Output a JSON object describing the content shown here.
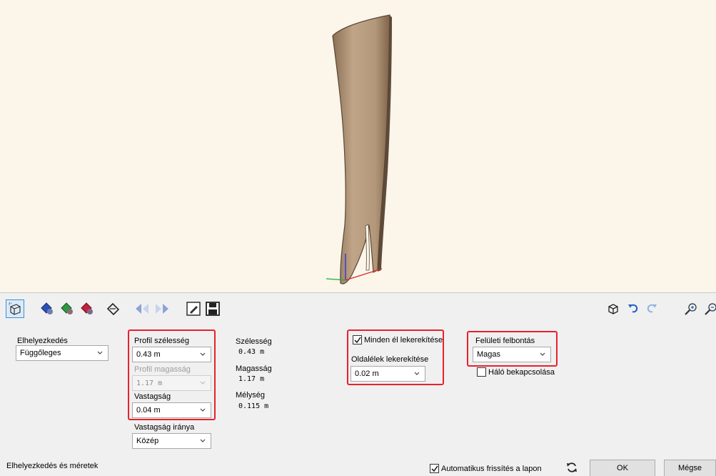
{
  "toolbar": {
    "icons": [
      "mesh-cube-icon",
      "paint-blue-icon",
      "paint-green-icon",
      "paint-red-icon",
      "paint-bucket-icon",
      "symmetry-left-icon",
      "symmetry-right-icon",
      "edit-pencil-icon",
      "save-icon",
      "view-cube-icon",
      "undo-icon",
      "redo-icon",
      "zoom-in-icon",
      "zoom-out-icon"
    ]
  },
  "placement": {
    "label": "Elhelyezkedés",
    "value": "Függőleges"
  },
  "profile": {
    "width_label": "Profil szélesség",
    "width_value": "0.43 m",
    "height_label": "Profil magasság",
    "height_value": "1.17 m",
    "thickness_label": "Vastagság",
    "thickness_value": "0.04 m",
    "thickness_dir_label": "Vastagság iránya",
    "thickness_dir_value": "Közép"
  },
  "dimensions": {
    "width_label": "Szélesség",
    "width_value": "0.43 m",
    "height_label": "Magasság",
    "height_value": "1.17 m",
    "depth_label": "Mélység",
    "depth_value": "0.115 m"
  },
  "rounding": {
    "all_edges_label": "Minden él lekerekítése",
    "all_edges_checked": true,
    "side_edges_label": "Oldalélek lekerekítése",
    "side_edges_value": "0.02 m"
  },
  "surface": {
    "resolution_label": "Felületi felbontás",
    "resolution_value": "Magas",
    "mesh_label": "Háló bekapcsolása",
    "mesh_checked": false
  },
  "footer": {
    "section_label": "Elhelyezkedés és méretek",
    "auto_refresh_label": "Automatikus frissítés a lapon",
    "auto_refresh_checked": true,
    "ok_label": "OK",
    "cancel_label": "Mégse"
  },
  "colors": {
    "highlight": "#e8212b",
    "viewport_bg": "#fbf5ea",
    "model": "#b59a7e"
  }
}
